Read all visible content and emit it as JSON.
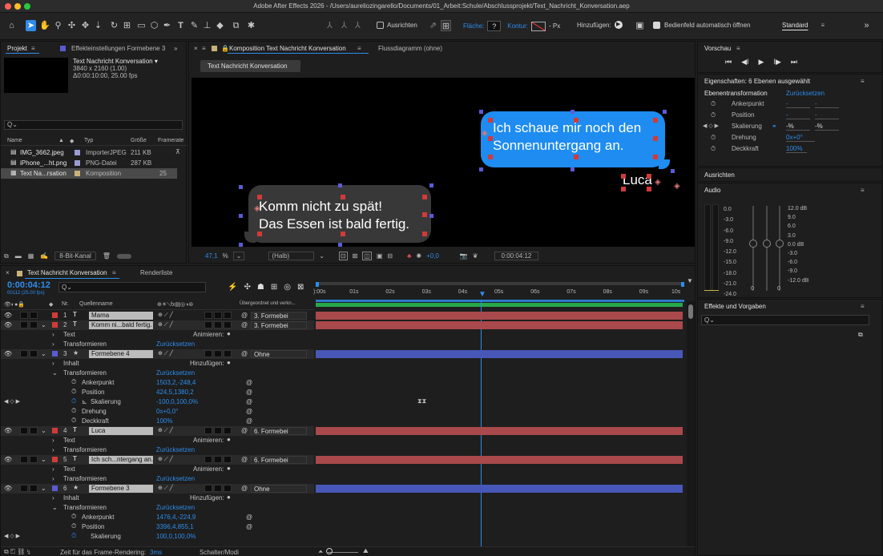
{
  "window": {
    "title": "Adobe After Effects 2026 - /Users/aureliozingarello/Documents/01_Arbeit:Schule/Abschlussprojekt/Text_Nachricht_Konversation.aep"
  },
  "toolbar": {
    "align_label": "Ausrichten",
    "fill_label": "Fläche:",
    "fill_value": "?",
    "stroke_label": "Kontur:",
    "stroke_unit": "- Px",
    "add_label": "Hinzufügen:",
    "auto_open_label": "Bedienfeld automatisch öffnen",
    "workspace": "Standard"
  },
  "project": {
    "tab_project": "Projekt",
    "tab_effects": "Effekteinstellungen Formebene 3",
    "comp_name": "Text Nachricht Konversation ▾",
    "comp_res": "3840 x 2160 (1.00)",
    "comp_dur": "Δ0:00:10:00, 25.00 fps",
    "search_placeholder": "Q⌄",
    "col_name": "Name",
    "col_type": "Typ",
    "col_size": "Größe",
    "col_fps": "Framerate",
    "items": [
      {
        "name": "IMG_3662.jpeg",
        "type": "ImporterJPEG",
        "size": "211 KB",
        "fps": ""
      },
      {
        "name": "iPhone_...ht.png",
        "type": "PNG-Datei",
        "size": "287 KB",
        "fps": ""
      },
      {
        "name": "Text Na...rsation",
        "type": "Komposition",
        "size": "",
        "fps": "25"
      }
    ],
    "bit_depth": "8-Bit-Kanal"
  },
  "composition": {
    "tab_label": "Komposition Text Nachricht Konversation",
    "flow_label": "Flussdiagramm (ohne)",
    "comp_button": "Text Nachricht Konversation",
    "zoom": "47,1",
    "zoom_unit": "%",
    "resolution": "(Halb)",
    "exposure": "+0,0",
    "timecode": "0:00:04:12",
    "bubble_blue_line1": "Ich schaue mir noch den",
    "bubble_blue_line2": "Sonnenuntergang an.",
    "bubble_gray_line1": "Komm nicht zu spät!",
    "bubble_gray_line2": "Das Essen ist bald fertig.",
    "name_tag": "Luca"
  },
  "preview": {
    "title": "Vorschau"
  },
  "properties": {
    "title": "Eigenschaften: 6 Ebenen ausgewählt",
    "section": "Ebenentransformation",
    "reset": "Zurücksetzen",
    "anchor": "Ankerpunkt",
    "position": "Position",
    "scale": "Skalierung",
    "scale_x": "-%",
    "scale_y": "-%",
    "dash": "-",
    "rotation": "Drehung",
    "rotation_value": "0x+0°",
    "opacity": "Deckkraft",
    "opacity_value": "100%"
  },
  "align_panel": {
    "title": "Ausrichten"
  },
  "audio": {
    "title": "Audio",
    "left_scale": [
      "0.0",
      "-3.0",
      "-6.0",
      "-9.0",
      "-12.0",
      "-15.0",
      "-18.0",
      "-21.0",
      "-24.0"
    ],
    "right_scale": [
      "12.0 dB",
      "9.0",
      "6.0",
      "3.0",
      "0.0 dB",
      "-3.0",
      "-6.0",
      "-9.0",
      "-12.0 dB"
    ],
    "zero_left": "0",
    "zero_right": "0"
  },
  "effects": {
    "title": "Effekte und Vorgaben",
    "search_placeholder": "Q⌄"
  },
  "timeline": {
    "tab_label": "Text Nachricht Konversation",
    "render_tab": "Renderliste",
    "timecode": "0:00:04:12",
    "frame_info": "00112 (25.00 fps)",
    "search_placeholder": "Q⌄",
    "col_nr": "Nr.",
    "col_source": "Quellenname",
    "col_parent": "Übergeordnet und verkn...",
    "ruler": [
      "):00s",
      "01s",
      "02s",
      "03s",
      "04s",
      "05s",
      "06s",
      "07s",
      "08s",
      "09s",
      "10s"
    ],
    "animate_label": "Animieren:",
    "add_label": "Hinzufügen:",
    "reset_label": "Zurücksetzen",
    "text_label": "Text",
    "transform_label": "Transformieren",
    "content_label": "Inhalt",
    "anchor_label": "Ankerpunkt",
    "position_label": "Position",
    "scale_label": "Skalierung",
    "rotation_label": "Drehung",
    "opacity_label": "Deckkraft",
    "layers": [
      {
        "nr": "1",
        "name": "Mama",
        "parent": "3. Formebei"
      },
      {
        "nr": "2",
        "name": "Komm ni...bald fertig.",
        "parent": "3. Formebei"
      },
      {
        "nr": "3",
        "name": "Formebene 4",
        "parent": "Ohne"
      },
      {
        "nr": "4",
        "name": "Luca",
        "parent": "6. Formebei"
      },
      {
        "nr": "5",
        "name": "Ich sch...ntergang an.",
        "parent": "6. Formebei"
      },
      {
        "nr": "6",
        "name": "Formebene 3",
        "parent": "Ohne"
      }
    ],
    "l3_anchor": "1503,2,-248,4",
    "l3_position": "424,5,1380,2",
    "l3_scale": "-100,0,100,0%",
    "l3_rotation": "0x+0,0°",
    "l3_opacity": "100%",
    "l6_anchor": "1476,4,-224,9",
    "l6_position": "3396,4,855,1",
    "l6_scale": "100,0,100,0%",
    "render_time_label": "Zeit für das Frame-Rendering:",
    "render_time_value": "3ms",
    "switch_modes": "Schalter/Modi"
  }
}
